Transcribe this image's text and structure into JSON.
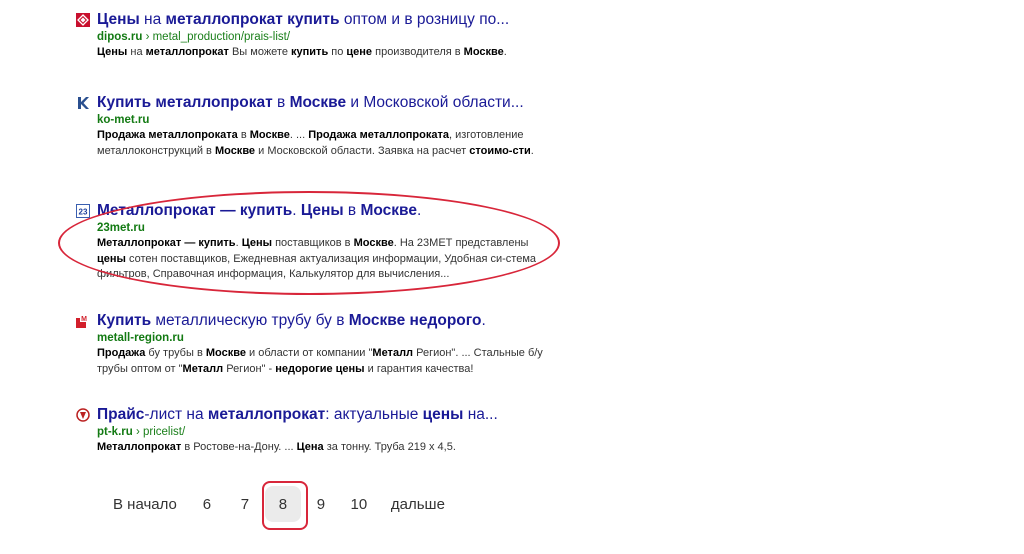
{
  "results": [
    {
      "favicon": "dipos-diamond-icon",
      "title_parts": [
        {
          "t": "Цены",
          "b": true
        },
        {
          "t": " на ",
          "b": false
        },
        {
          "t": "металлопрокат купить",
          "b": true
        },
        {
          "t": " оптом и в розницу по...",
          "b": false
        }
      ],
      "domain": "dipos.ru",
      "path": " › metal_production/prais-list/",
      "snippet_parts": [
        {
          "t": "Цены",
          "b": true
        },
        {
          "t": " на ",
          "b": false
        },
        {
          "t": "металлопрокат",
          "b": true
        },
        {
          "t": " Вы можете ",
          "b": false
        },
        {
          "t": "купить",
          "b": true
        },
        {
          "t": " по ",
          "b": false
        },
        {
          "t": "цене",
          "b": true
        },
        {
          "t": " производителя в ",
          "b": false
        },
        {
          "t": "Москве",
          "b": true
        },
        {
          "t": ".",
          "b": false
        }
      ]
    },
    {
      "favicon": "k-letter-icon",
      "title_parts": [
        {
          "t": "Купить металлопрокат",
          "b": true
        },
        {
          "t": " в ",
          "b": false
        },
        {
          "t": "Москве",
          "b": true
        },
        {
          "t": " и Московской области...",
          "b": false
        }
      ],
      "domain": "ko-met.ru",
      "path": "",
      "snippet_parts": [
        {
          "t": "Продажа металлопроката",
          "b": true
        },
        {
          "t": " в ",
          "b": false
        },
        {
          "t": "Москве",
          "b": true
        },
        {
          "t": ". ... ",
          "b": false
        },
        {
          "t": "Продажа металлопроката",
          "b": true
        },
        {
          "t": ", изготовление металлоконструкций в ",
          "b": false
        },
        {
          "t": "Москве",
          "b": true
        },
        {
          "t": " и Московской области. Заявка на расчет ",
          "b": false
        },
        {
          "t": "стоимо-сти",
          "b": true
        },
        {
          "t": ".",
          "b": false
        }
      ]
    },
    {
      "favicon": "23met-icon",
      "favicon_text": "23",
      "title_parts": [
        {
          "t": "Металлопрокат — купить",
          "b": true
        },
        {
          "t": ". ",
          "b": false
        },
        {
          "t": "Цены",
          "b": true
        },
        {
          "t": " в ",
          "b": false
        },
        {
          "t": "Москве",
          "b": true
        },
        {
          "t": ".",
          "b": false
        }
      ],
      "domain": "23met.ru",
      "path": "",
      "snippet_parts": [
        {
          "t": "Металлопрокат — купить",
          "b": true
        },
        {
          "t": ". ",
          "b": false
        },
        {
          "t": "Цены",
          "b": true
        },
        {
          "t": " поставщиков в ",
          "b": false
        },
        {
          "t": "Москве",
          "b": true
        },
        {
          "t": ". На 23МЕТ представлены ",
          "b": false
        },
        {
          "t": "цены",
          "b": true
        },
        {
          "t": " сотен поставщиков, Ежедневная актуализация информации, Удобная си-стема фильтров, Справочная информация, Калькулятор для вычисления...",
          "b": false
        }
      ]
    },
    {
      "favicon": "metall-region-icon",
      "title_parts": [
        {
          "t": "Купить",
          "b": true
        },
        {
          "t": " металлическую трубу бу в ",
          "b": false
        },
        {
          "t": "Москве недорого",
          "b": true
        },
        {
          "t": ".",
          "b": false
        }
      ],
      "domain": "metall-region.ru",
      "path": "",
      "snippet_parts": [
        {
          "t": "Продажа",
          "b": true
        },
        {
          "t": " бу трубы в ",
          "b": false
        },
        {
          "t": "Москве",
          "b": true
        },
        {
          "t": " и области от компании \"",
          "b": false
        },
        {
          "t": "Металл",
          "b": true
        },
        {
          "t": " Регион\". ... Стальные б/у трубы оптом от \"",
          "b": false
        },
        {
          "t": "Металл",
          "b": true
        },
        {
          "t": " Регион\" - ",
          "b": false
        },
        {
          "t": "недорогие цены",
          "b": true
        },
        {
          "t": " и гарантия качества!",
          "b": false
        }
      ]
    },
    {
      "favicon": "pt-k-emblem-icon",
      "title_parts": [
        {
          "t": "Прайс",
          "b": true
        },
        {
          "t": "-лист на ",
          "b": false
        },
        {
          "t": "металлопрокат",
          "b": true
        },
        {
          "t": ": актуальные ",
          "b": false
        },
        {
          "t": "цены",
          "b": true
        },
        {
          "t": " на...",
          "b": false
        }
      ],
      "domain": "pt-k.ru",
      "path": " › pricelist/",
      "snippet_parts": [
        {
          "t": "Металлопрокат",
          "b": true
        },
        {
          "t": " в Ростове-на-Дону. ... ",
          "b": false
        },
        {
          "t": "Цена",
          "b": true
        },
        {
          "t": " за тонну. Труба 219 x 4,5.",
          "b": false
        }
      ]
    }
  ],
  "pagination": {
    "start_label": "В начало",
    "pages": [
      "6",
      "7",
      "8",
      "9",
      "10"
    ],
    "current": "8",
    "next_label": "дальше"
  },
  "colors": {
    "title_link": "#1a1a96",
    "url_green": "#1a7f1a",
    "annotation_red": "#d8263a",
    "current_page_bg": "#ebebeb"
  }
}
